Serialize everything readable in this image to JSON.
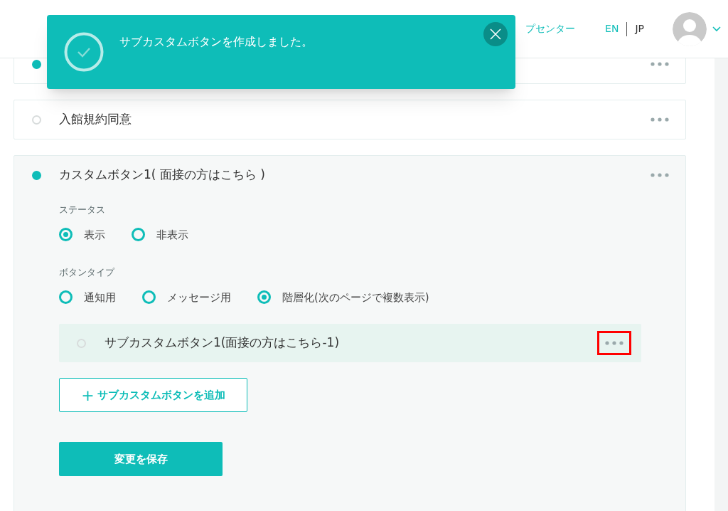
{
  "header": {
    "help_link": "プセンター",
    "languages": [
      {
        "label": "EN",
        "selected": true
      },
      {
        "label": "JP",
        "selected": false
      }
    ]
  },
  "toast": {
    "message": "サブカスタムボタンを作成しました。"
  },
  "cards": [
    {
      "active": true,
      "expanded": false
    },
    {
      "title": "入館規約同意",
      "active": false,
      "expanded": false
    },
    {
      "title": "カスタムボタン1( 面接の方はこちら )",
      "active": true,
      "expanded": true,
      "sections": [
        {
          "label": "ステータス",
          "options": [
            {
              "label": "表示",
              "selected": true
            },
            {
              "label": "非表示",
              "selected": false
            }
          ]
        },
        {
          "label": "ボタンタイプ",
          "options": [
            {
              "label": "通知用",
              "selected": false
            },
            {
              "label": "メッセージ用",
              "selected": false
            },
            {
              "label": "階層化(次のページで複数表示)",
              "selected": true
            }
          ]
        }
      ],
      "sub_buttons": [
        {
          "title": "サブカスタムボタン1(面接の方はこちら-1)",
          "active": false,
          "highlighted": true
        }
      ],
      "add_button": {
        "icon": "+",
        "label": "サブカスタムボタンを追加"
      },
      "save_button": "変更を保存"
    }
  ]
}
